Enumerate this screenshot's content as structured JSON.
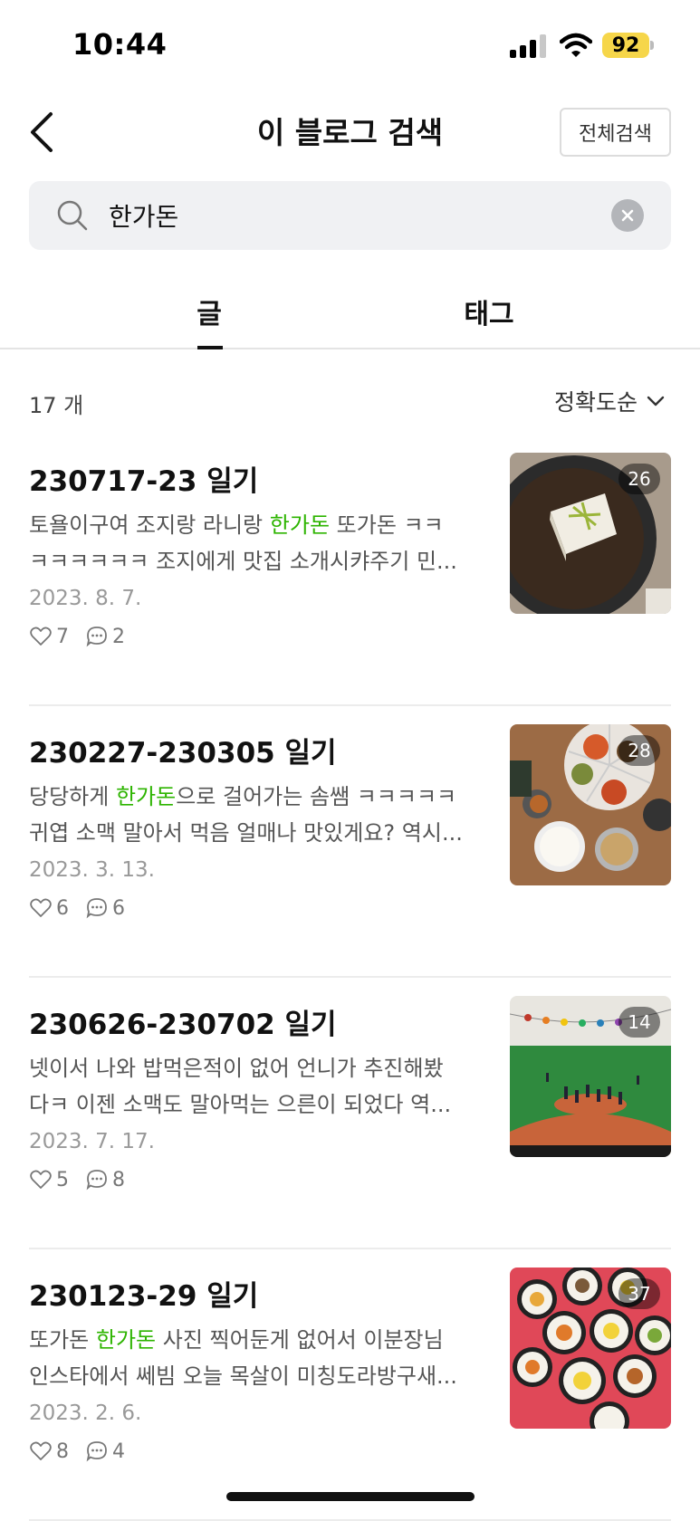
{
  "status_bar": {
    "time": "10:44",
    "battery": "92"
  },
  "header": {
    "title": "이 블로그 검색",
    "full_search_label": "전체검색"
  },
  "search": {
    "value": "한가돈"
  },
  "tabs": [
    {
      "label": "글",
      "active": true
    },
    {
      "label": "태그",
      "active": false
    }
  ],
  "results": {
    "count_label": "17 개",
    "sort_label": "정확도순"
  },
  "posts": [
    {
      "title": "230717-23 일기",
      "line1_pre": "토욜이구여 조지랑 라니랑 ",
      "line1_hl": "한가돈",
      "line1_post": " 또가돈 ㅋㅋ",
      "line2": "ㅋㅋㅋㅋㅋㅋ 조지에게 맛집 소개시캬주기 민...",
      "date": "2023. 8. 7.",
      "likes": "7",
      "comments": "2",
      "image_count": "26"
    },
    {
      "title": "230227-230305 일기",
      "line1_pre": "당당하게 ",
      "line1_hl": "한가돈",
      "line1_post": "으로 걸어가는 솜쌤 ㅋㅋㅋㅋㅋ",
      "line2": "귀엽 소맥 말아서 먹음 얼매나 맛있게요? 역시...",
      "date": "2023. 3. 13.",
      "likes": "6",
      "comments": "6",
      "image_count": "28"
    },
    {
      "title": "230626-230702 일기",
      "line1_pre": "넷이서 나와 밥먹은적이 없어 언니가 추진해봤",
      "line1_hl": "",
      "line1_post": "",
      "line2": "다ㅋ 이젠 소맥도 말아먹는 으른이 되었다 역...",
      "date": "2023. 7. 17.",
      "likes": "5",
      "comments": "8",
      "image_count": "14"
    },
    {
      "title": "230123-29 일기",
      "line1_pre": "또가돈 ",
      "line1_hl": "한가돈",
      "line1_post": " 사진 찍어둔게 없어서 이분장님",
      "line2": "인스타에서 쎄빔 오늘 목살이 미칭도라방구새...",
      "date": "2023. 2. 6.",
      "likes": "8",
      "comments": "4",
      "image_count": "37"
    }
  ],
  "colors": {
    "highlight": "#2db400",
    "battery": "#f6d64a"
  }
}
